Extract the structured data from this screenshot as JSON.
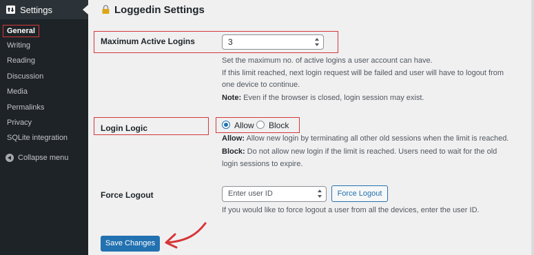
{
  "sidebar": {
    "header_label": "Settings",
    "items": [
      {
        "label": "General",
        "active": true
      },
      {
        "label": "Writing"
      },
      {
        "label": "Reading"
      },
      {
        "label": "Discussion"
      },
      {
        "label": "Media"
      },
      {
        "label": "Permalinks"
      },
      {
        "label": "Privacy"
      },
      {
        "label": "SQLite integration"
      }
    ],
    "collapse_label": "Collapse menu"
  },
  "page": {
    "title": "Loggedin Settings"
  },
  "max_logins": {
    "label": "Maximum Active Logins",
    "value": "3",
    "desc1": "Set the maximum no. of active logins a user account can have.",
    "desc2_line1": "If this limit reached, next login request will be failed and user will have to logout from",
    "desc2_line2": "one device to continue.",
    "note_label": "Note:",
    "note_text": " Even if the browser is closed, login session may exist."
  },
  "login_logic": {
    "label": "Login Logic",
    "options": [
      {
        "label": "Allow",
        "checked": true
      },
      {
        "label": "Block",
        "checked": false
      }
    ],
    "allow_label": "Allow:",
    "allow_text": " Allow new login by terminating all other old sessions when the limit is reached.",
    "block_label": "Block:",
    "block_text_line1": " Do not allow new login if the limit is reached. Users need to wait for the old",
    "block_text_line2": "login sessions to expire."
  },
  "force_logout": {
    "label": "Force Logout",
    "placeholder": "Enter user ID",
    "button_label": "Force Logout",
    "desc": "If you would like to force logout a user from all the devices, enter the user ID."
  },
  "save_label": "Save Changes",
  "colors": {
    "accent": "#2271b1",
    "highlight": "#d63638",
    "sidebar": "#1d2327"
  }
}
